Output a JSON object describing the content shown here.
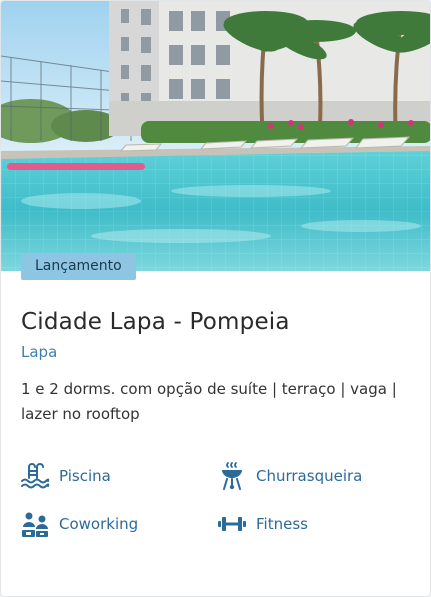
{
  "card": {
    "badge": "Lançamento",
    "title": "Cidade Lapa - Pompeia",
    "location": "Lapa",
    "description": "1 e 2 dorms. com opção de suíte | terraço | vaga | lazer no rooftop",
    "amenities": [
      {
        "label": "Piscina",
        "icon": "pool-icon"
      },
      {
        "label": "Churrasqueira",
        "icon": "grill-icon"
      },
      {
        "label": "Coworking",
        "icon": "coworking-icon"
      },
      {
        "label": "Fitness",
        "icon": "dumbbell-icon"
      }
    ]
  },
  "colors": {
    "badge_bg": "#8ec5e2",
    "accent_blue": "#2c6a9a",
    "location_blue": "#3f7fb0",
    "title_text": "#2a2a2a",
    "pool_water": "#3fc0cc"
  }
}
